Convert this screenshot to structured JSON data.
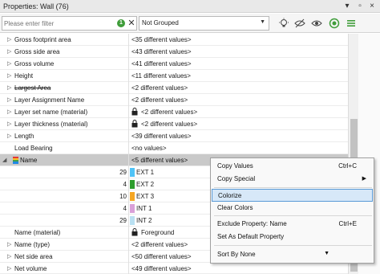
{
  "panel": {
    "title": "Properties: Wall (76)"
  },
  "toolbar": {
    "filter_placeholder": "Please enter filter",
    "filter_badge": "1",
    "grouping_value": "Not Grouped"
  },
  "properties": [
    {
      "name": "Gross footprint area",
      "value": "<35 different values>"
    },
    {
      "name": "Gross side area",
      "value": "<43 different values>"
    },
    {
      "name": "Gross volume",
      "value": "<41 different values>"
    },
    {
      "name": "Height",
      "value": "<11 different values>"
    },
    {
      "name": "Largest Area",
      "value": "<2 different values>"
    },
    {
      "name": "Layer Assignment Name",
      "value": "<2 different values>"
    },
    {
      "name": "Layer set name (material)",
      "value": "<2 different values>"
    },
    {
      "name": "Layer thickness (material)",
      "value": "<2 different values>"
    },
    {
      "name": "Length",
      "value": "<39 different values>"
    },
    {
      "name": "Load Bearing",
      "value": "<no values>"
    },
    {
      "name": "Name",
      "value": "<5 different values>"
    }
  ],
  "name_values": [
    {
      "count": "29",
      "label": "EXT 1",
      "color": "#4fc3f7"
    },
    {
      "count": "4",
      "label": "EXT 2",
      "color": "#2e9d2e"
    },
    {
      "count": "10",
      "label": "EXT 3",
      "color": "#f5a623"
    },
    {
      "count": "4",
      "label": "INT 1",
      "color": "#d9a0d9"
    },
    {
      "count": "29",
      "label": "INT 2",
      "color": "#b9e0f2"
    }
  ],
  "properties_after": [
    {
      "name": "Name (material)",
      "value": "Foreground"
    },
    {
      "name": "Name (type)",
      "value": "<2 different values>"
    },
    {
      "name": "Net side area",
      "value": "<50 different values>"
    },
    {
      "name": "Net volume",
      "value": "<49 different values>"
    }
  ],
  "context_menu": {
    "copy_values": "Copy Values",
    "copy_values_shortcut": "Ctrl+C",
    "copy_special": "Copy Special",
    "colorize": "Colorize",
    "clear_colors": "Clear Colors",
    "exclude_property": "Exclude Property: Name",
    "exclude_shortcut": "Ctrl+E",
    "set_default": "Set As Default Property",
    "sort_by": "Sort By None"
  },
  "colors": {
    "selected_row": "#c9c9c9",
    "menu_highlight": "#d7e8f8",
    "accent_green": "#3f9d3a"
  }
}
